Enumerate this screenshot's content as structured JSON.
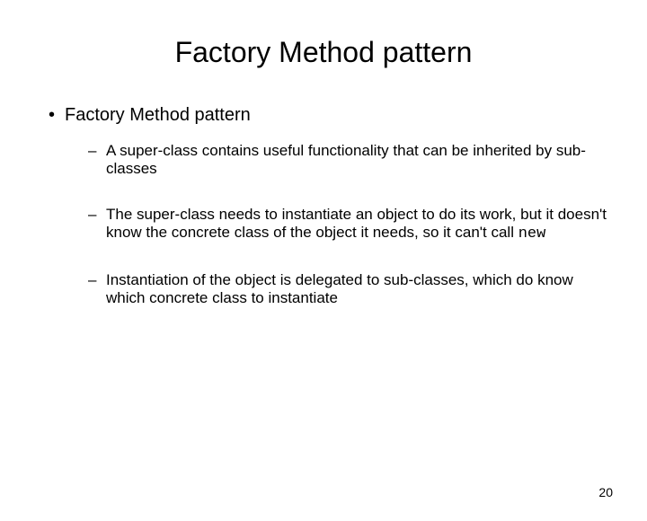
{
  "title": "Factory Method pattern",
  "bullet": {
    "symbol": "•",
    "text": "Factory Method pattern",
    "sub": [
      {
        "dash": "–",
        "text": "A super-class contains useful functionality that can be inherited by sub-classes"
      },
      {
        "dash": "–",
        "text_before": "The super-class needs to instantiate an object to do its work, but it doesn't know the concrete class of the object it needs, so it can't call ",
        "code": "new"
      },
      {
        "dash": "–",
        "text": "Instantiation of the object is delegated to sub-classes, which do know which concrete class to instantiate"
      }
    ]
  },
  "page_number": "20"
}
